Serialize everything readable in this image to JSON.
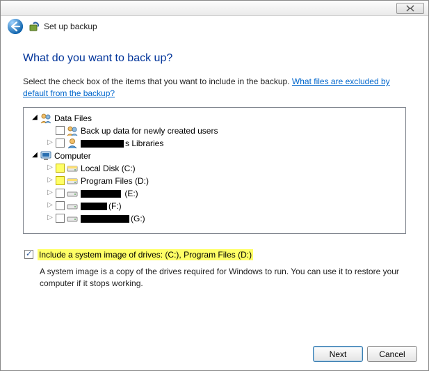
{
  "window": {
    "title": "Set up backup"
  },
  "page": {
    "heading": "What do you want to back up?",
    "instruction_prefix": "Select the check box of the items that you want to include in the backup. ",
    "exclude_link": "What files are excluded by default from the backup?"
  },
  "tree": {
    "root_data_files": "Data Files",
    "new_users": "Back up data for newly created users",
    "libraries_suffix": "s Libraries",
    "root_computer": "Computer",
    "local_c": "Local Disk (C:)",
    "program_d": "Program Files (D:)",
    "drive_e_suffix": " (E:)",
    "drive_f_suffix": "(F:)",
    "drive_g_suffix": "(G:)"
  },
  "system_image": {
    "checkbox_label": "Include a system image of drives: (C:), Program Files (D:)",
    "description": "A system image is a copy of the drives required for Windows to run. You can use it to restore your computer if it stops working."
  },
  "buttons": {
    "next": "Next",
    "cancel": "Cancel"
  }
}
